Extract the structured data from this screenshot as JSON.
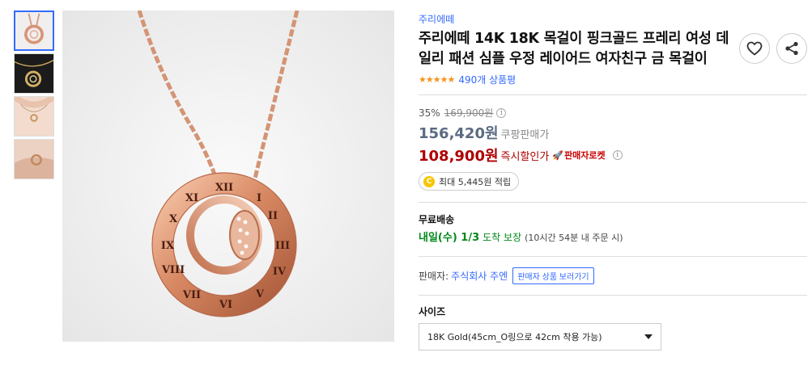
{
  "product": {
    "brand": "주리에떼",
    "title": "주리에떼 14K 18K 목걸이 핑크골드 프레리 여성 데일리 패션 심플 우정 레이어드 여자친구 금 목걸이",
    "rating_stars": "★★★★★",
    "review_count": "490개 상품평"
  },
  "actions": {
    "wishlist_icon": "heart-icon",
    "share_icon": "share-icon"
  },
  "price": {
    "discount_rate": "35%",
    "original_price": "169,900원",
    "coupang_price": "156,420원",
    "coupang_price_label": "쿠팡판매가",
    "sale_price": "108,900원",
    "sale_label": "즉시할인가",
    "rocket_badge": "판매자로켓",
    "info_glyph": "i",
    "reward": "최대 5,445원 적립",
    "reward_coin": "C"
  },
  "shipping": {
    "title": "무료배송",
    "arrival": "내일(수) 1/3",
    "guarantee": "도착 보장",
    "note": "(10시간 54분 내 주문 시)"
  },
  "seller": {
    "label": "판매자:",
    "name": "주식회사 주엔",
    "button": "판매자 상품 보러가기"
  },
  "option": {
    "label": "사이즈",
    "selected": "18K Gold(45cm_O링으로 42cm 착용 가능)"
  },
  "colors": {
    "accent": "#346aff",
    "sale_red": "#ae0000",
    "shipping_green": "#00891a",
    "star_orange": "#f7931e"
  }
}
